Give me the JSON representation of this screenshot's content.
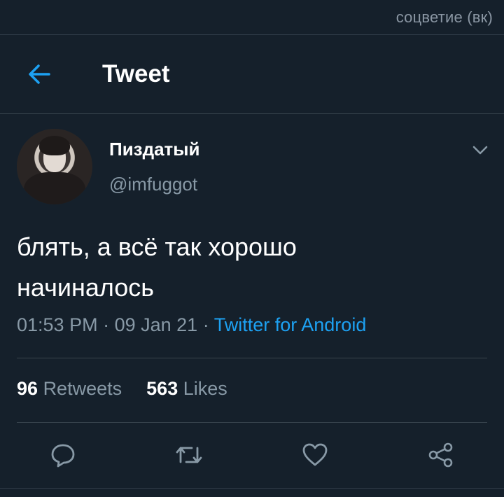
{
  "watermark": "соцветие (вк)",
  "header": {
    "title": "Tweet",
    "back_icon": "arrow-left-icon"
  },
  "tweet": {
    "author_name": "Пиздатый",
    "author_handle": "@imfuggot",
    "text_line1": "блять, а всё так хорошо",
    "text_line2": "начиналось",
    "time": "01:53 PM",
    "date": "09 Jan 21",
    "source": "Twitter for Android",
    "retweets_count": "96",
    "retweets_label": "Retweets",
    "likes_count": "563",
    "likes_label": "Likes"
  },
  "colors": {
    "background": "#15202b",
    "accent": "#1da1f2",
    "secondary_text": "#8899a6"
  },
  "icons": {
    "reply": "reply-icon",
    "retweet": "retweet-icon",
    "like": "heart-icon",
    "share": "share-icon",
    "menu": "chevron-down-icon"
  }
}
